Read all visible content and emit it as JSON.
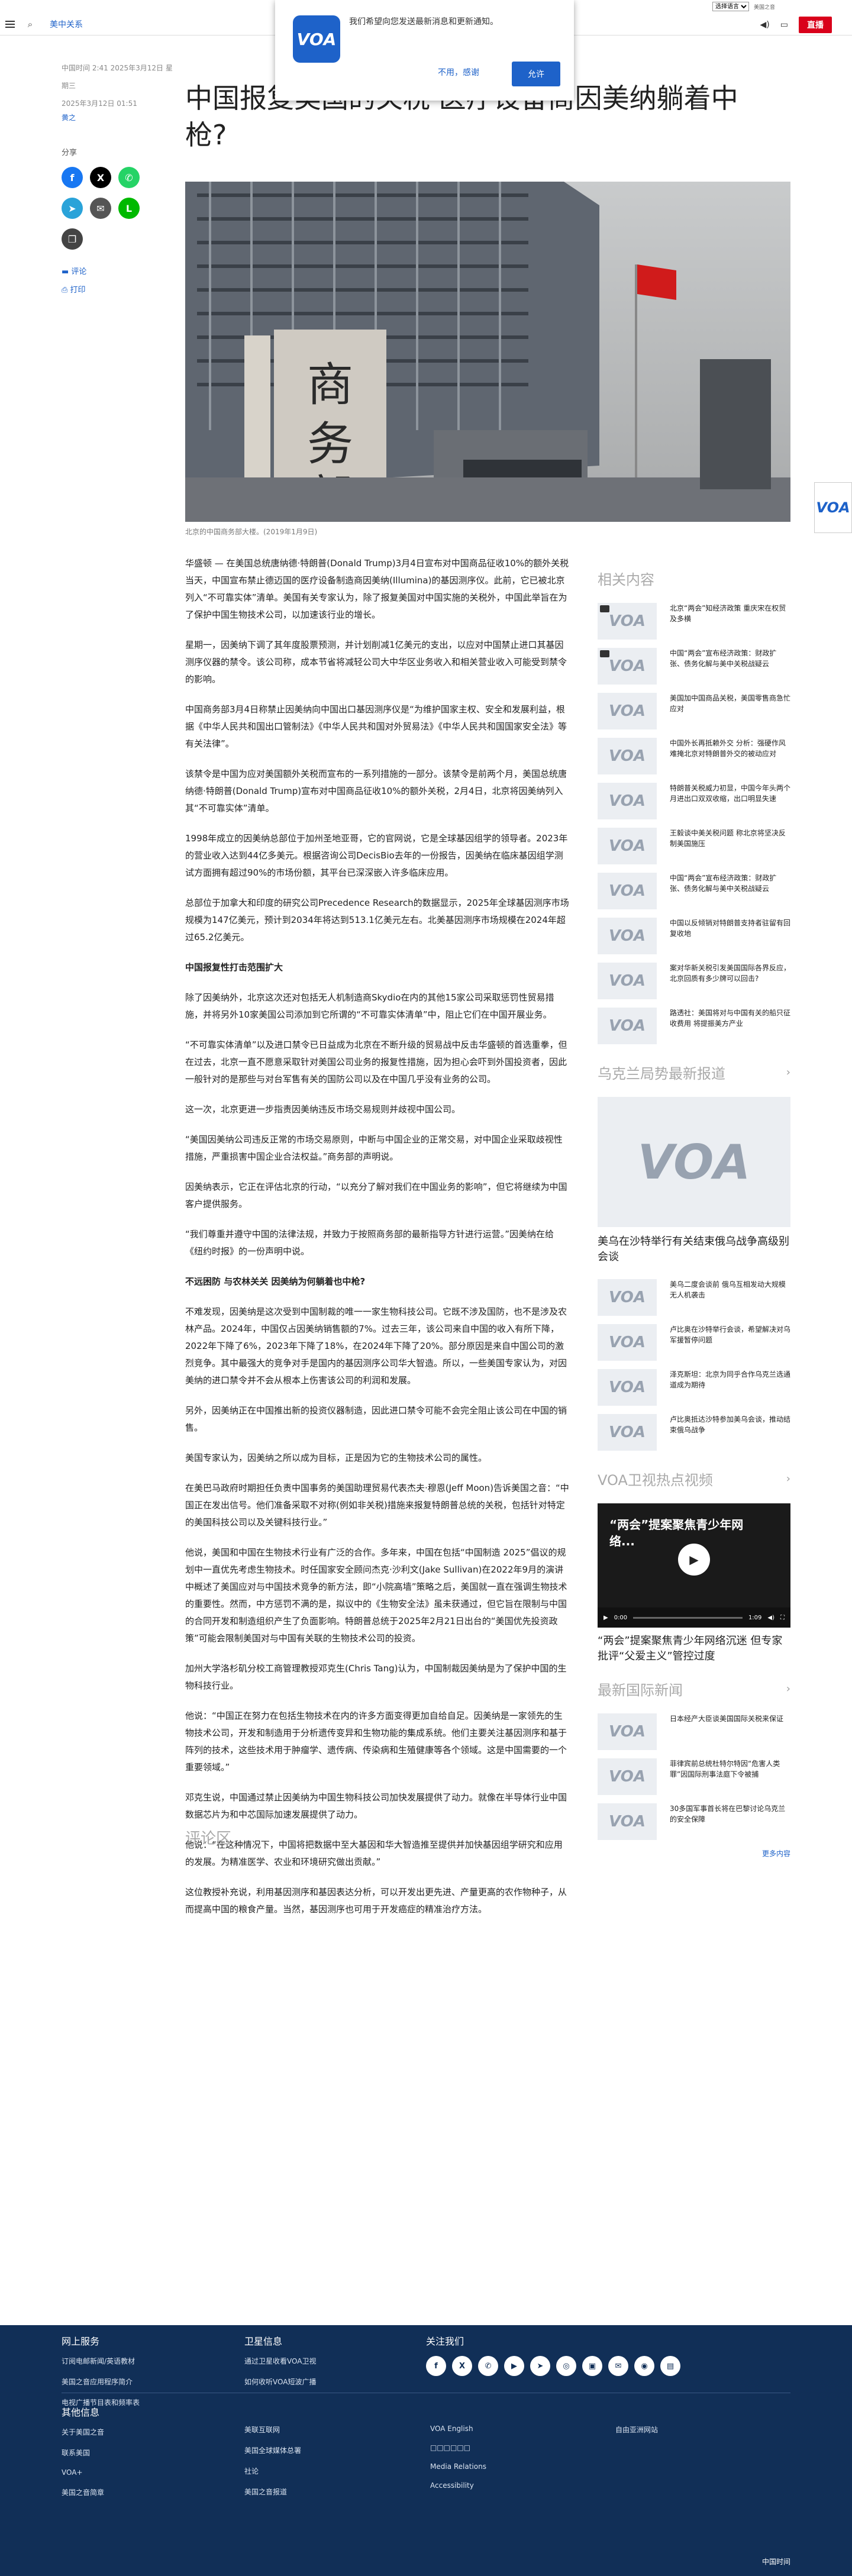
{
  "top": {
    "language": "选择语言",
    "extra": "美国之音"
  },
  "header": {
    "section": "美中关系",
    "live": "直播"
  },
  "popup": {
    "text": "我们希望向您发送最新消息和更新通知。",
    "no": "不用，感谢",
    "yes": "允许",
    "logo": "VOA"
  },
  "left": {
    "published": "中国时间 2:41 2025年3月12日 星期三",
    "updated": "2025年3月12日 01:51",
    "author": "黄之",
    "share": "分享",
    "comments": "评论",
    "print": "打印"
  },
  "title": "中国报复美国的关税 医疗设备商因美纳躺着中枪?",
  "caption": "北京的中国商务部大楼。(2019年1月9日)",
  "article": {
    "p1": "华盛顿 — 在美国总统唐纳德·特朗普(Donald Trump)3月4日宣布对中国商品征收10%的额外关税当天，中国宣布禁止德迈国的医疗设备制造商因美纳(Illumina)的基因测序仪。此前，它已被北京列入“不可靠实体”清单。美国有关专家认为，除了报复美国对中国实施的关税外，中国此举旨在为了保护中国生物技术公司，以加速该行业的增长。",
    "p2": "星期一，因美纳下调了其年度股票预测，并计划削减1亿美元的支出，以应对中国禁止进口其基因测序仪器的禁令。该公司称，成本节省将减轻公司大中华区业务收入和相关营业收入可能受到禁令的影响。",
    "p3": "中国商务部3月4日称禁止因美纳向中国出口基因测序仪是“为维护国家主权、安全和发展利益，根据《中华人民共和国出口管制法》《中华人民共和国对外贸易法》《中华人民共和国国家安全法》等有关法律”。",
    "p4": "该禁令是中国为应对美国额外关税而宣布的一系列措施的一部分。该禁令是前两个月，美国总统唐纳德·特朗普(Donald Trump)宣布对中国商品征收10%的额外关税，2月4日，北京将因美纳列入其“不可靠实体”清单。",
    "p5": "1998年成立的因美纳总部位于加州圣地亚哥，它的官网说，它是全球基因组学的领导者。2023年的营业收入达到44亿多美元。根据咨询公司DecisBio去年的一份报告，因美纳在临床基因组学测试方面拥有超过90%的市场份额，其平台已深深嵌入许多临床应用。",
    "p6": "总部位于加拿大和印度的研究公司Precedence Research的数据显示，2025年全球基因测序市场规模为147亿美元，预计到2034年将达到513.1亿美元左右。北美基因测序市场规模在2024年超过65.2亿美元。",
    "h1": "中国报复性打击范围扩大",
    "p7": "除了因美纳外，北京这次还对包括无人机制造商Skydio在内的其他15家公司采取惩罚性贸易措施，并将另外10家美国公司添加到它所谓的“不可靠实体清单”中，阻止它们在中国开展业务。",
    "p8": "“不可靠实体清单”以及进口禁令已日益成为北京在不断升级的贸易战中反击华盛顿的首选重拳，但在过去，北京一直不愿意采取针对美国公司业务的报复性措施，因为担心会吓到外国投资者，因此一般针对的是那些与对台军售有关的国防公司以及在中国几乎没有业务的公司。",
    "p9": "这一次，北京更进一步指责因美纳违反市场交易规则并歧视中国公司。",
    "p10": "“美国因美纳公司违反正常的市场交易原则，中断与中国企业的正常交易，对中国企业采取歧视性措施，严重损害中国企业合法权益。”商务部的声明说。",
    "p11": "因美纳表示，它正在评估北京的行动，“以充分了解对我们在中国业务的影响”，但它将继续为中国客户提供服务。",
    "p12": "“我们尊重并遵守中国的法律法规，并致力于按照商务部的最新指导方针进行运营。”因美纳在给《纽约时报》的一份声明中说。",
    "h2": "不远困防 与农林关关 因美纳为何躺着也中枪?",
    "p13": "不难发现，因美纳是这次受到中国制裁的唯一一家生物科技公司。它既不涉及国防，也不是涉及农林产品。2024年，中国仅占因美纳销售额的7%。过去三年，该公司来自中国的收入有所下降，2022年下降了6%，2023年下降了18%，在2024年下降了20%。部分原因是来自中国公司的激烈竞争。其中最强大的竞争对手是国内的基因测序公司华大智造。所以，一些美国专家认为，对因美纳的进口禁令并不会从根本上伤害该公司的利润和发展。",
    "p14": "另外，因美纳正在中国推出新的投资仪器制造，因此进口禁令可能不会完全阻止该公司在中国的销售。",
    "p15": "美国专家认为，因美纳之所以成为目标，正是因为它的生物技术公司的属性。",
    "p16": "在美巴马政府时期担任负责中国事务的美国助理贸易代表杰夫·穆恩(Jeff Moon)告诉美国之音：“中国正在发出信号。他们准备采取不对称(例如非关税)措施来报复特朗普总统的关税，包括针对特定的美国科技公司以及关键科技行业。”",
    "p17": "他说，美国和中国在生物技术行业有广泛的合作。多年来，中国在包括“中国制造 2025”倡议的规划中一直优先考虑生物技术。时任国家安全顾问杰克·沙利文(Jake Sullivan)在2022年9月的演讲中概述了美国应对与中国技术竞争的新方法，即“小院高墙”策略之后，美国就一直在强调生物技术的重要性。然而，中方惩罚不满的是，拟议中的《生物安全法》虽未获通过，但它旨在限制与中国的合同开发和制造组织产生了负面影响。特朗普总统于2025年2月21日出台的“美国优先投资政策”可能会限制美国对与中国有关联的生物技术公司的投资。",
    "p18": "加州大学洛杉矶分校工商管理教授邓克生(Chris Tang)认为，中国制裁因美纳是为了保护中国的生物科技行业。",
    "p19": "他说：“中国正在努力在包括生物技术在内的许多方面变得更加自给自足。因美纳是一家领先的生物技术公司，开发和制造用于分析遗传变异和生物功能的集成系统。他们主要关注基因测序和基于阵列的技术，这些技术用于肿瘤学、遗传病、传染病和生殖健康等各个领域。这是中国需要的一个重要领域。”",
    "p20": "邓克生说，中国通过禁止因美纳为中国生物科技公司加快发展提供了动力。就像在半导体行业中国数据芯片为和中芯国际加速发展提供了动力。",
    "p21": "他说：“在这种情况下，中国将把数据中至大基因和华大智造推至提供并加快基因组学研究和应用的发展。为精准医学、农业和环境研究做出贡献。”",
    "p22": "这位教授补充说，利用基因测序和基因表达分析，可以开发出更先进、产量更高的农作物种子，从而提高中国的粮食产量。当然，基因测序也可用于开发癌症的精准治疗方法。"
  },
  "comments_title": "评论区",
  "sidebar": {
    "related_h": "相关内容",
    "related": [
      {
        "text": "北京“两会”知经济政策 重庆宋在权贸及多横",
        "cam": true
      },
      {
        "text": "中国“两会”宣布经济政策：财政扩张、债务化解与美中关税战疑云",
        "cam": true
      },
      {
        "text": "美国加中国商品关税，美国零售商急忙应对",
        "cam": false
      },
      {
        "text": "中国外长再抵赖外交 分析：强硬作风难掩北京对特朗普外交的被动应对",
        "cam": false
      },
      {
        "text": "特朗普关税威力初显，中国今年头两个月进出口双双收缩，出口明显失速",
        "cam": false
      },
      {
        "text": "王毅谈中美关税问题 称北京将坚决反制美国施压",
        "cam": false
      },
      {
        "text": "中国“两会”宣布经济政策：财政扩张、债务化解与美中关税战疑云",
        "cam": false
      },
      {
        "text": "中国以反倾销对特朗普支持者驻留有回复收地",
        "cam": false
      },
      {
        "text": "案对华新关税引发美国国际各界反应，北京回质有多少牌可以回击?",
        "cam": false
      },
      {
        "text": "路透社：美国将对与中国有关的船只征收费用 将提振美方产业",
        "cam": false
      }
    ],
    "ukraine_h": "乌克兰局势最新报道",
    "ukraine_big": "美乌在沙特举行有关结束俄乌战争高级别会谈",
    "ukraine": [
      {
        "text": "美乌二度会谈前 俄乌互相发动大规模无人机袭击"
      },
      {
        "text": "卢比奥在沙特举行会谈，希望解决对乌军援暂停问题"
      },
      {
        "text": "泽克斯坦：北京为同乎合作乌克兰选通道成为期待"
      },
      {
        "text": "卢比奥抵达沙特参加美乌会谈，推动结束俄乌战争"
      }
    ],
    "video_h": "VOA卫视热点视频",
    "video_title": "“两会”提案聚焦青少年网络...",
    "video_time": "0:00",
    "video_dur": "1:09",
    "video_caption": "“两会”提案聚焦青少年网络沉迷 但专家批评“父爱主义”管控过度",
    "intl_h": "最新国际新闻",
    "intl": [
      {
        "text": "日本经产大臣谈美国国际关税来保证"
      },
      {
        "text": "菲律宾前总统杜特尔特因“危害人类罪”因国际刑事法庭下令被捕"
      },
      {
        "text": "30多国军事首长将在巴黎讨论乌克兰的安全保障"
      }
    ],
    "more": "更多内容"
  },
  "footer": {
    "about_h": "网上服务",
    "about": [
      "订阅电邮新闻/英语教材",
      "美国之音应用程序简介",
      "电视广播节目表和频率表"
    ],
    "sat_h": "卫星信息",
    "sat": [
      "通过卫星收看VOA卫视",
      "如何收听VOA短波广播"
    ],
    "follow_h": "关注我们",
    "social": [
      "f",
      "X",
      "✆",
      "▶",
      "➤",
      "◎",
      "▣",
      "✉",
      "◉",
      "▤"
    ],
    "other_h": "其他信息",
    "c1": [
      "关于美国之音",
      "联系美国",
      "VOA+",
      "美国之音简章"
    ],
    "c2": [
      "美联互联网",
      "美国全球媒体总署",
      "社论",
      "美国之音报道"
    ],
    "c3": [
      "VOA English",
      "□□□□□□",
      "Media Relations",
      "Accessibility"
    ],
    "c4": [
      "自由亚洲网站"
    ],
    "copyright": "中国时间"
  },
  "colors": {
    "brand": "#1e62c9",
    "footer": "#112f57",
    "live": "#d9001b"
  }
}
